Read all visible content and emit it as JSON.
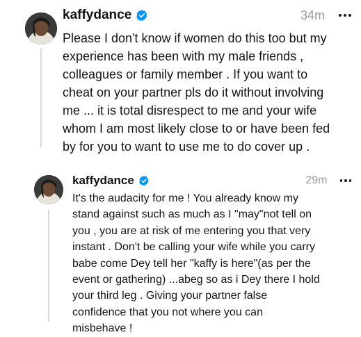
{
  "posts": [
    {
      "username": "kaffydance",
      "verified": true,
      "timestamp": "34m",
      "more_icon": "more-horizontal-icon",
      "text": "Please I don't know if women do this too but my\nexperience has been with my male friends ,\ncolleagues or family member . If you want to\ncheat on your partner pls do it without involving\nme ... it is total disrespect to me and your wife\nwhom I am most likely close to or have been fed\nby for you to want to use me to do cover up ."
    },
    {
      "username": "kaffydance",
      "verified": true,
      "timestamp": "29m",
      "more_icon": "more-horizontal-icon",
      "text": "It's the audacity for me ! You already know my\nstand against such as much as I \"may\"not tell on\nyou , you are at risk of me entering you that very\ninstant . Don't be calling your wife while you carry\nbabe come Dey tell her \"kaffy is here\"(as per the\nevent or gathering) ...abeg so as i Dey there I hold\nyour third leg . Giving your partner false\nconfidence that you not where you can\nmisbehave !"
    }
  ],
  "colors": {
    "verified_badge": "#0095f6",
    "timestamp": "#9a9a9a",
    "thread_line": "#d9d9d9"
  }
}
